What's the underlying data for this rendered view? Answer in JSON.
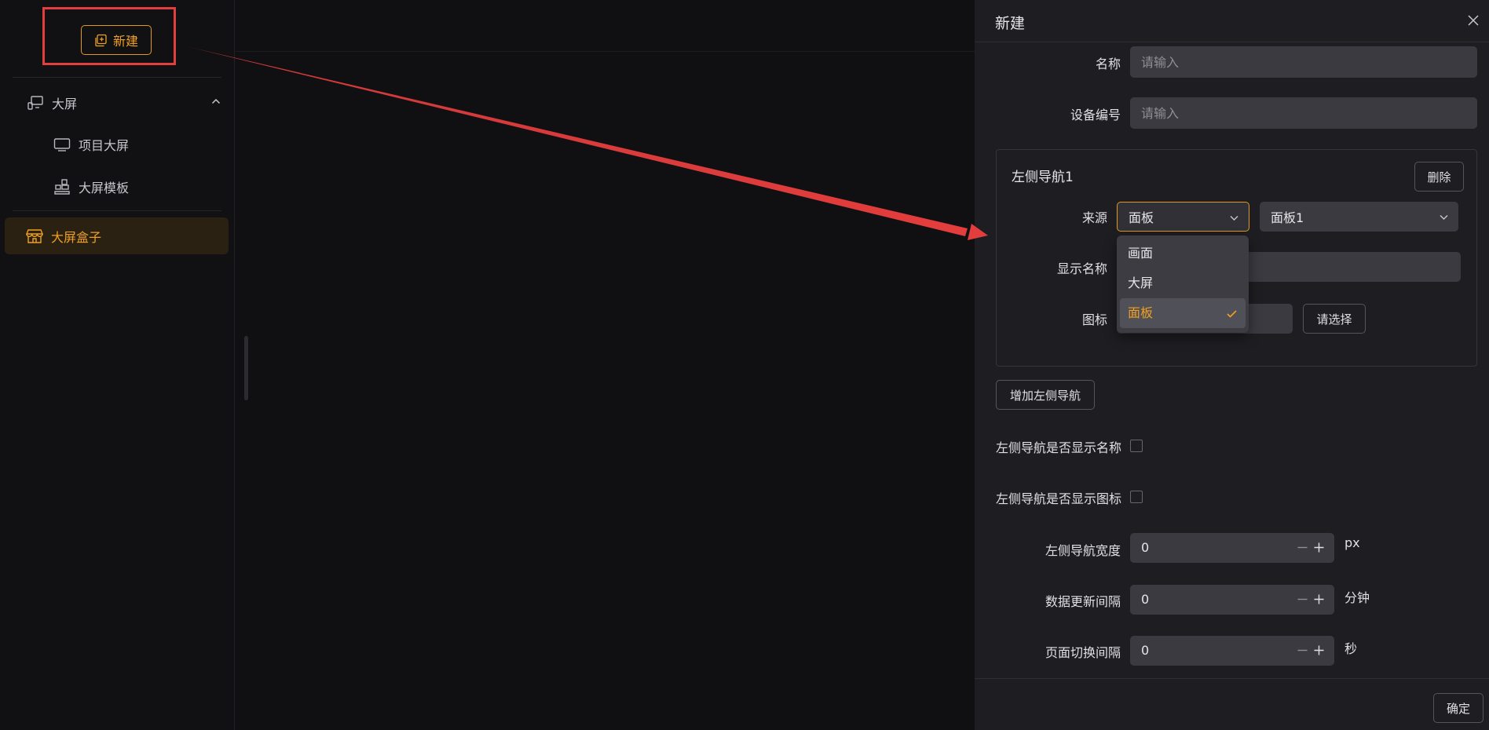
{
  "sidebar": {
    "new_button_label": "新建",
    "group_label": "大屏",
    "sub_items": [
      "项目大屏",
      "大屏模板"
    ],
    "active_item_label": "大屏盒子"
  },
  "drawer": {
    "title": "新建",
    "fields": {
      "name_label": "名称",
      "name_placeholder": "请输入",
      "device_label": "设备编号",
      "device_placeholder": "请输入"
    },
    "nav_card": {
      "title": "左侧导航1",
      "delete_label": "删除",
      "source_label": "来源",
      "source_value": "面板",
      "source_target_value": "面板1",
      "display_name_label": "显示名称",
      "icon_label": "图标",
      "choose_label": "请选择"
    },
    "source_options": [
      {
        "label": "画面",
        "selected": false
      },
      {
        "label": "大屏",
        "selected": false
      },
      {
        "label": "面板",
        "selected": true
      }
    ],
    "add_nav_label": "增加左侧导航",
    "show_name_label": "左侧导航是否显示名称",
    "show_icon_label": "左侧导航是否显示图标",
    "nav_width": {
      "label": "左侧导航宽度",
      "value": "0",
      "unit": "px"
    },
    "refresh_interval": {
      "label": "数据更新间隔",
      "value": "0",
      "unit": "分钟"
    },
    "switch_interval": {
      "label": "页面切换间隔",
      "value": "0",
      "unit": "秒"
    },
    "ok_label": "确定"
  },
  "colors": {
    "accent": "#f0a020",
    "annotation_red": "#e43d3d",
    "background": "#101013",
    "drawer": "#1e1e22"
  }
}
